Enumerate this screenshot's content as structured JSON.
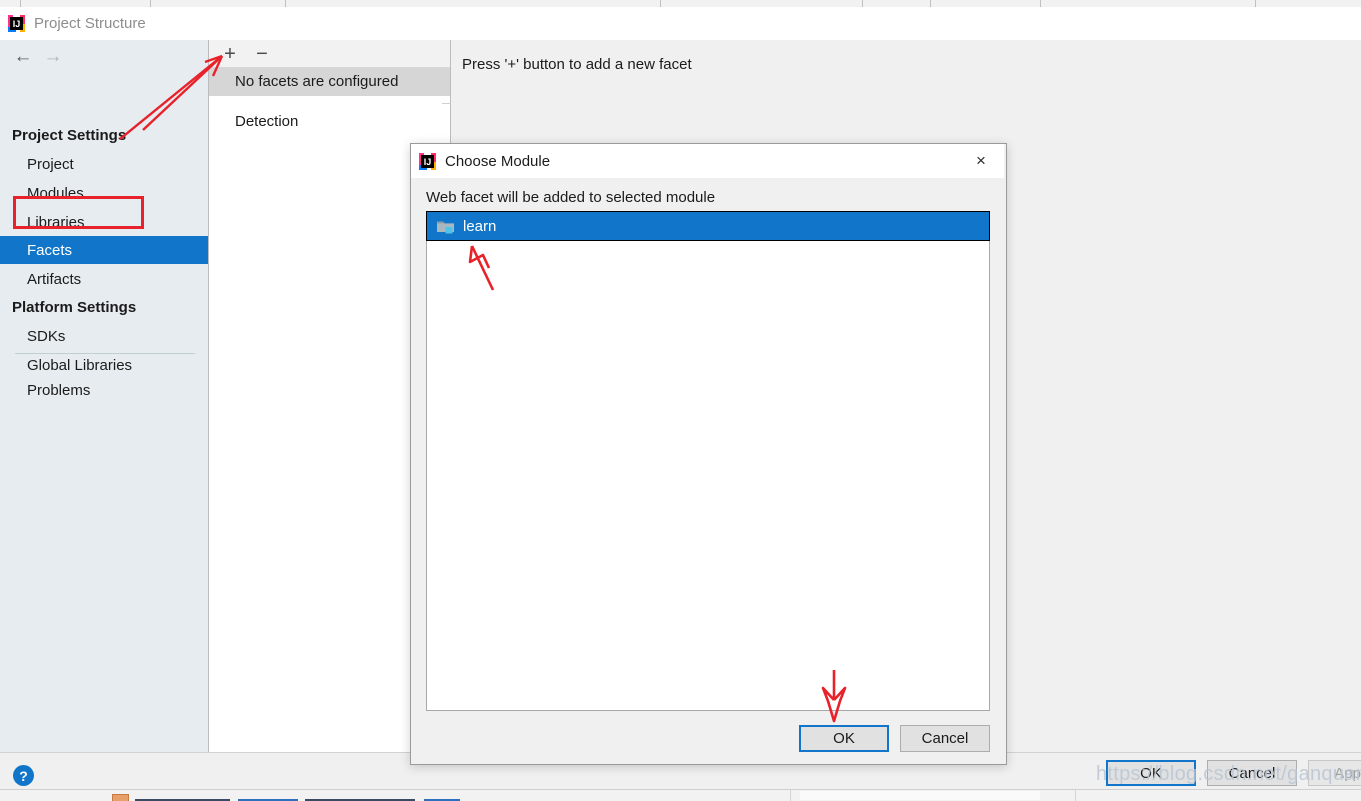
{
  "window": {
    "title": "Project Structure",
    "app_icon": "intellij-idea-icon",
    "nav": {
      "back_icon": "arrow-left-icon",
      "forward_icon": "arrow-right-icon"
    },
    "help_label": "?",
    "buttons": {
      "ok": "OK",
      "cancel": "Cancel",
      "apply": "Apply"
    }
  },
  "sidebar": {
    "groups": [
      {
        "title": "Project Settings",
        "items": [
          {
            "label": "Project",
            "selected": false
          },
          {
            "label": "Modules",
            "selected": false
          },
          {
            "label": "Libraries",
            "selected": false
          },
          {
            "label": "Facets",
            "selected": true
          },
          {
            "label": "Artifacts",
            "selected": false
          }
        ]
      },
      {
        "title": "Platform Settings",
        "items": [
          {
            "label": "SDKs",
            "selected": false
          },
          {
            "label": "Global Libraries",
            "selected": false
          }
        ]
      }
    ],
    "footer_item": "Problems"
  },
  "facets_panel": {
    "toolbar": {
      "add_label": "+",
      "remove_label": "−"
    },
    "header_row": "No facets are configured",
    "rows": [
      "Detection"
    ]
  },
  "detail_panel": {
    "hint": "Press '+' button to add a new facet"
  },
  "dialog": {
    "title": "Choose Module",
    "app_icon": "intellij-idea-icon",
    "close_label": "×",
    "subtitle": "Web facet will be added to selected module",
    "modules": [
      {
        "label": "learn",
        "icon": "module-folder-icon",
        "selected": true
      }
    ],
    "buttons": {
      "ok": "OK",
      "cancel": "Cancel"
    }
  },
  "watermark": "https://blog.csdn.net/ganquanzhong",
  "underlay": {
    "bottom_text": "ceandfilesmappennail"
  },
  "colors": {
    "accent": "#1176c9",
    "annotation_red": "#e8222a",
    "selected_row": "#1176c9",
    "header_row_gray": "#d6d6d6",
    "sidebar_bg": "#e6ecf0",
    "window_bg": "#f0f0f0"
  }
}
